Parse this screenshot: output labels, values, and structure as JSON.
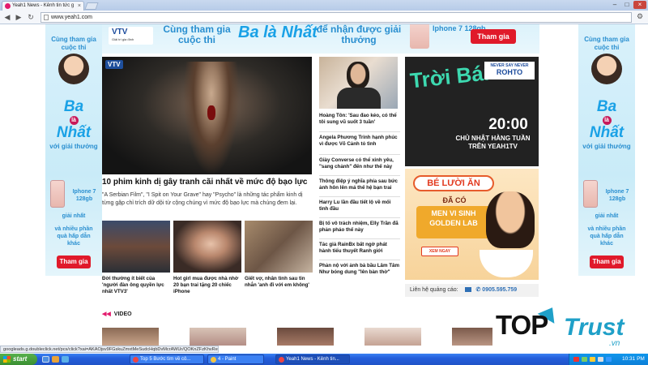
{
  "browser": {
    "tab_title": "Yeah1 News - Kênh tin tức g",
    "url": "www.yeah1.com"
  },
  "top_ad": {
    "logo": "VTV",
    "logo_sub": "Giải trí gia đình",
    "line1": "Cùng tham gia cuộc thi",
    "mid": "Ba là Nhất",
    "line2": "để nhận được giải thưởng",
    "prize": "Iphone 7 128gb",
    "button": "Tham gia"
  },
  "side_ad": {
    "line1": "Cùng tham gia cuộc thi",
    "ba": "Ba",
    "la": "là",
    "nhat": "Nhất",
    "voi": "với giải thưởng",
    "prize": "Iphone 7 128gb",
    "giai_nhat": "giải nhất",
    "khac": "và nhiều phần quà hấp dẫn khác",
    "button": "Tham gia"
  },
  "hero": {
    "logo": "VTV",
    "title": "10 phim kinh dị gây tranh cãi nhất về mức độ bạo lực",
    "desc": "\"A Serbian Film\", \"I Spit on Your Grave\" hay \"Psycho\" là những tác phẩm kinh dị từng gặp chỉ trích dữ dội từ cộng chúng vì mức độ bạo lực mà chúng đem lại."
  },
  "thumbs": [
    {
      "caption": "Đời thường ít biết của 'người đàn ông quyền lực nhất VTV3'"
    },
    {
      "caption": "Hot girl mua được nhà nhờ 20 bạn trai tặng 20 chiếc iPhone"
    },
    {
      "caption": "Giết vợ, nhân tình sau tin nhắn 'anh đi với em không'"
    }
  ],
  "list": [
    "Hoàng Tôn: 'Sau đao kéo, có thể tôi sung vũ suốt 3 tuần'",
    "Angela Phương Trinh hạnh phúc vì được Võ Cảnh tỏ tình",
    "Giày Converse có thể xinh yêu, \"sang chảnh\" đến như thế này",
    "Thông điệp ý nghĩa phía sau bức ảnh hôn lên má thế hệ bạn trai",
    "Harry Lu lần đầu tiết lộ về mối tình đầu",
    "Bị tố vô trách nhiệm, Elly Trần đã phản pháo thế này",
    "Tác giả RainBx bất ngờ phát hành tiểu thuyết Ranh giới",
    "Phản nộ với ảnh bà bầu Lâm Tâm Như bóng dung \"lên bàn thờ\""
  ],
  "ad_trai_ban": {
    "title": "Trời Bán",
    "brand_top": "NEVER SAY NEVER",
    "brand": "ROHTO",
    "time": "20:00",
    "schedule": "CHỦ NHẬT HÀNG TUẦN TRÊN YEAH1TV"
  },
  "ad_be_luoi_an": {
    "title": "BÉ LƯỜI ĂN",
    "subtitle": "ĐÃ CÓ",
    "product": "MEN VI SINH GOLDEN LAB",
    "cta": "XEM NGAY"
  },
  "contact": {
    "label": "Liên hệ quảng cáo:",
    "phone": "0905.595.759"
  },
  "video_label": "VIDEO",
  "status_text": "googleads.g.doubleclick.net/pcs/click?xai=AKAOjsv9FGskuZmxtMeSudcHqbDvMcrAWUr/QOKnZFzKhvReQjBb3D",
  "taskbar": {
    "start": "start",
    "tasks": [
      "Top 5 Bước tìm về cô...",
      "4 - Paint",
      "Yeah1 News - Kênh tin..."
    ],
    "clock": "10:31 PM"
  },
  "watermark": {
    "top": "TOP",
    "trust": "Trust",
    "vn": ".vn"
  },
  "colors": {
    "accent": "#e31b6d",
    "ad_blue": "#2a8fd0",
    "taskbar": "#245edb",
    "start": "#3a8f31"
  }
}
